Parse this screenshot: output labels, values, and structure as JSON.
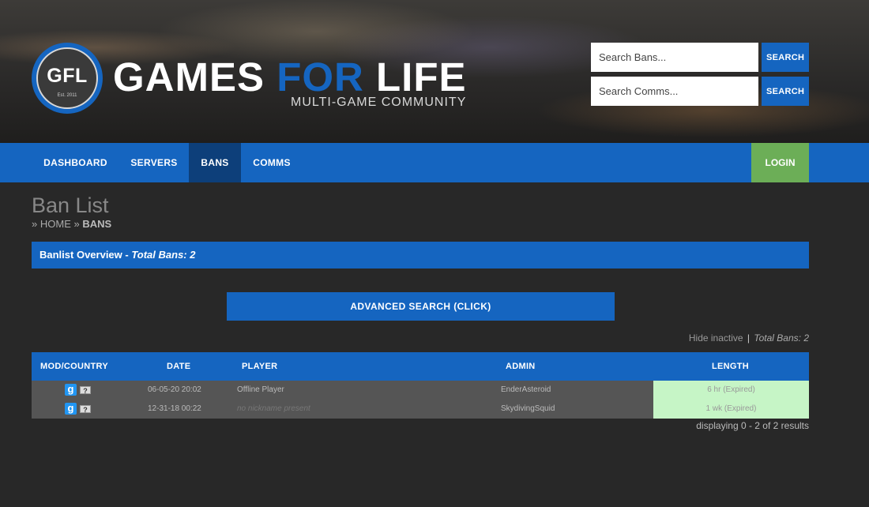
{
  "header": {
    "logo_text": "GFL",
    "logo_est": "Est. 2011",
    "brand_part1": "GAMES ",
    "brand_part2": "FOR",
    "brand_part3": " LIFE",
    "brand_sub": "MULTI-GAME COMMUNITY",
    "search_bans": {
      "placeholder": "Search Bans...",
      "button": "SEARCH"
    },
    "search_comms": {
      "placeholder": "Search Comms...",
      "button": "SEARCH"
    }
  },
  "nav": {
    "items": [
      {
        "label": "DASHBOARD",
        "active": false
      },
      {
        "label": "SERVERS",
        "active": false
      },
      {
        "label": "BANS",
        "active": true
      },
      {
        "label": "COMMS",
        "active": false
      }
    ],
    "login": "LOGIN"
  },
  "page": {
    "title": "Ban List",
    "breadcrumb": {
      "sep": "»",
      "home": "HOME",
      "current": "BANS"
    },
    "overview_label": "Banlist Overview - ",
    "overview_total": "Total Bans: 2",
    "advanced_search": "ADVANCED SEARCH (CLICK)",
    "hide_inactive": "Hide inactive",
    "hide_sep": "|",
    "total_bans": "Total Bans: 2",
    "displaying": "displaying 0 - 2 of 2 results"
  },
  "table": {
    "headers": [
      "MOD/COUNTRY",
      "DATE",
      "PLAYER",
      "ADMIN",
      "LENGTH"
    ],
    "rows": [
      {
        "mod_icon": "g",
        "country_icon": "?",
        "date": "06-05-20 20:02",
        "player": "Offline Player",
        "player_is_nick_missing": false,
        "admin": "EnderAsteroid",
        "length": "6 hr (Expired)"
      },
      {
        "mod_icon": "g",
        "country_icon": "?",
        "date": "12-31-18 00:22",
        "player": "no nickname present",
        "player_is_nick_missing": true,
        "admin": "SkydivingSquid",
        "length": "1 wk (Expired)"
      }
    ]
  },
  "colors": {
    "accent": "#1565c0",
    "nav_active": "#0d3f7a",
    "login": "#6cae57",
    "background": "#282828",
    "row": "#555555",
    "expired": "#c6f5c6"
  }
}
